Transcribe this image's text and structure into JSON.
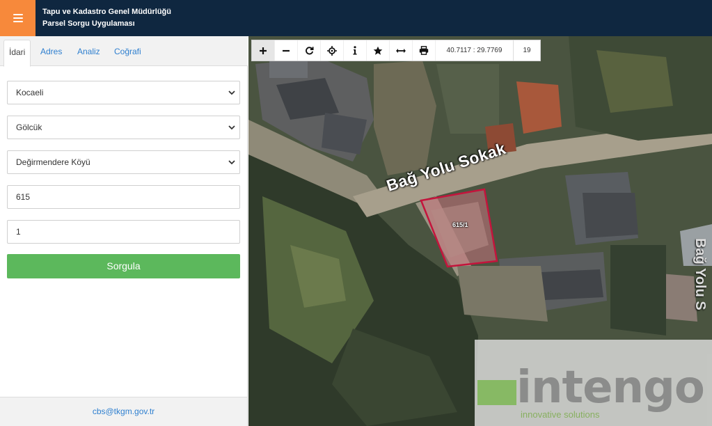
{
  "header": {
    "title_line1": "Tapu ve Kadastro Genel Müdürlüğü",
    "title_line2": "Parsel Sorgu Uygulaması"
  },
  "tabs": [
    {
      "label": "İdari",
      "active": true
    },
    {
      "label": "Adres",
      "active": false
    },
    {
      "label": "Analiz",
      "active": false
    },
    {
      "label": "Coğrafi",
      "active": false
    }
  ],
  "form": {
    "il": "Kocaeli",
    "ilce": "Gölcük",
    "mahalle": "Değirmendere Köyü",
    "ada": "615",
    "parsel": "1",
    "submit_label": "Sorgula"
  },
  "footer": {
    "email": "cbs@tkgm.gov.tr"
  },
  "map": {
    "toolbar": {
      "tools": [
        "zoom-in-icon",
        "zoom-out-icon",
        "refresh-icon",
        "locate-icon",
        "info-icon",
        "favorite-icon",
        "measure-icon",
        "print-icon"
      ],
      "coordinates": "40.7117 : 29.7769",
      "zoom_level": "19"
    },
    "street_label": "Bağ Yolu Sokak",
    "street_label_right": "Bağ Yolu S",
    "parcel_label": "615/1",
    "watermark_text": "intengo",
    "watermark_sub": "innovative solutions"
  },
  "colors": {
    "header_bg": "#0f2740",
    "menu_accent": "#f7893b",
    "query_button": "#5cb85c",
    "link_blue": "#2e7fcf",
    "parcel_outline": "#c4143c"
  }
}
